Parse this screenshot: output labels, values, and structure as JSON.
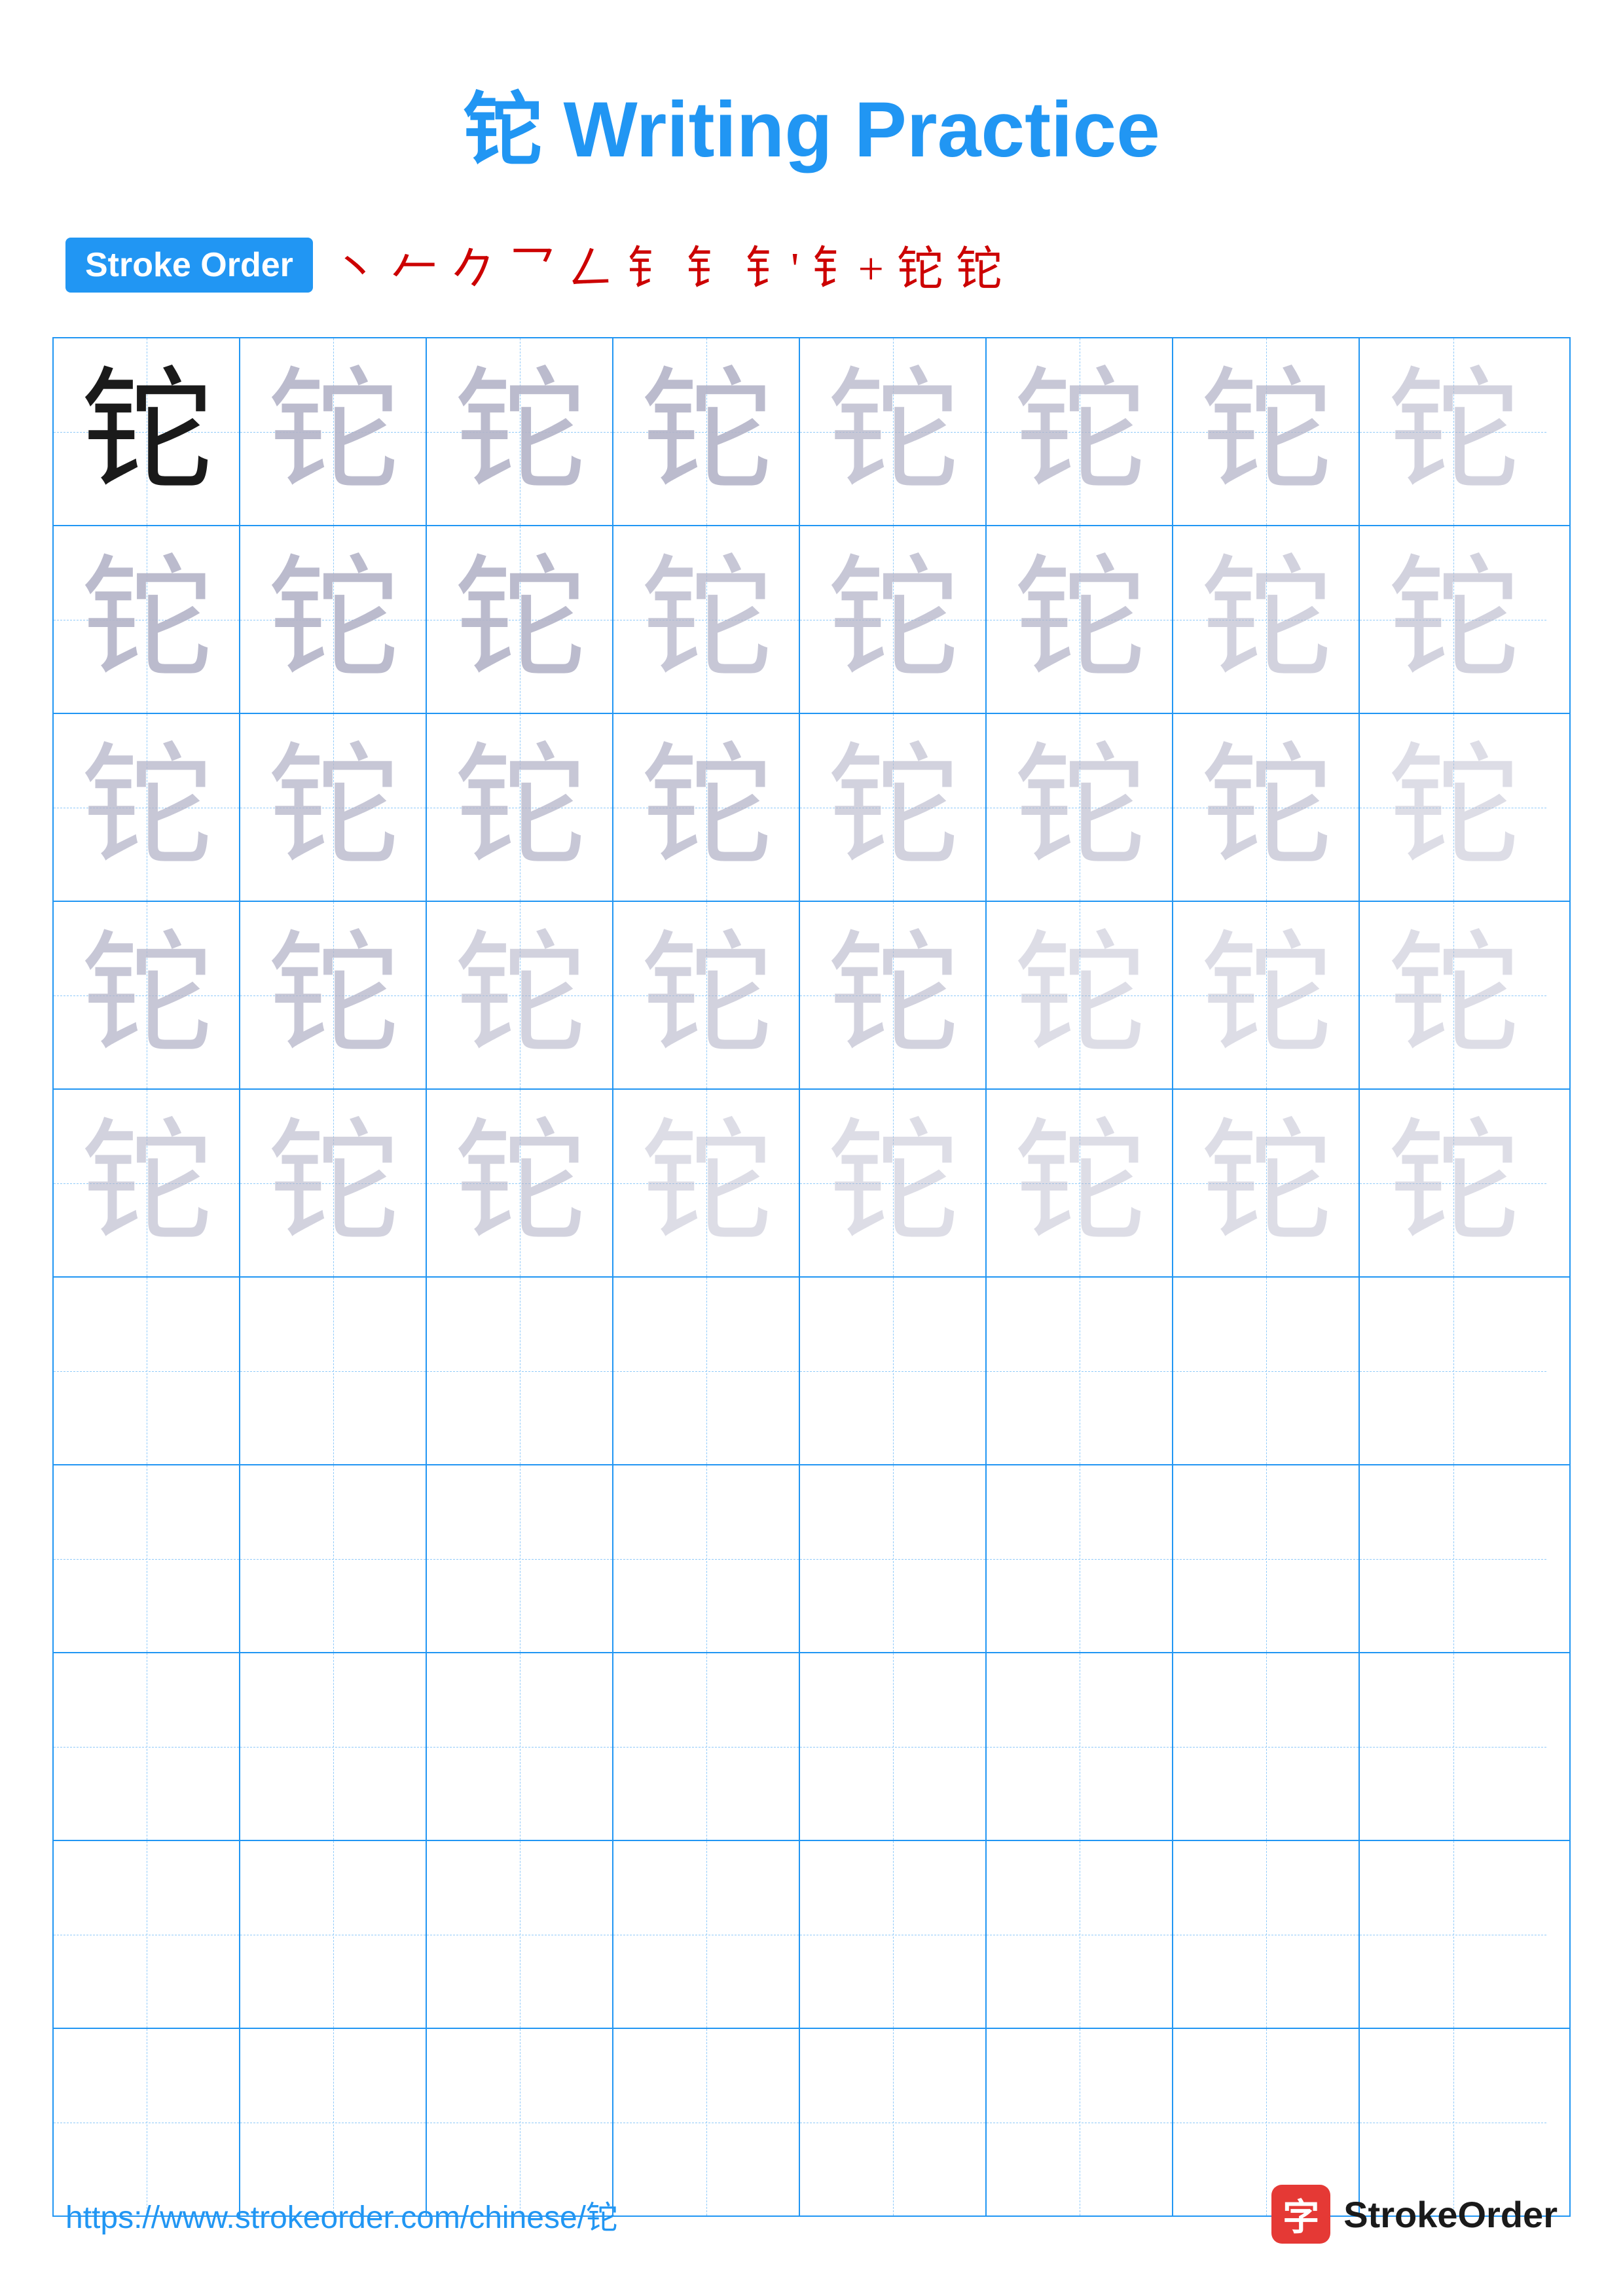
{
  "page": {
    "title": "铊 Writing Practice",
    "title_char": "铊",
    "title_suffix": " Writing Practice"
  },
  "stroke_order": {
    "badge_label": "Stroke Order",
    "strokes": [
      "丶",
      "𠂉",
      "𠂉",
      "⺂",
      "𠃋",
      "钅",
      "钅",
      "钅'",
      "钅+",
      "钅+",
      "钅+铊"
    ]
  },
  "grid": {
    "character": "铊",
    "rows": 10,
    "cols": 8
  },
  "footer": {
    "url": "https://www.strokeorder.com/chinese/铊",
    "brand": "StrokeOrder"
  }
}
